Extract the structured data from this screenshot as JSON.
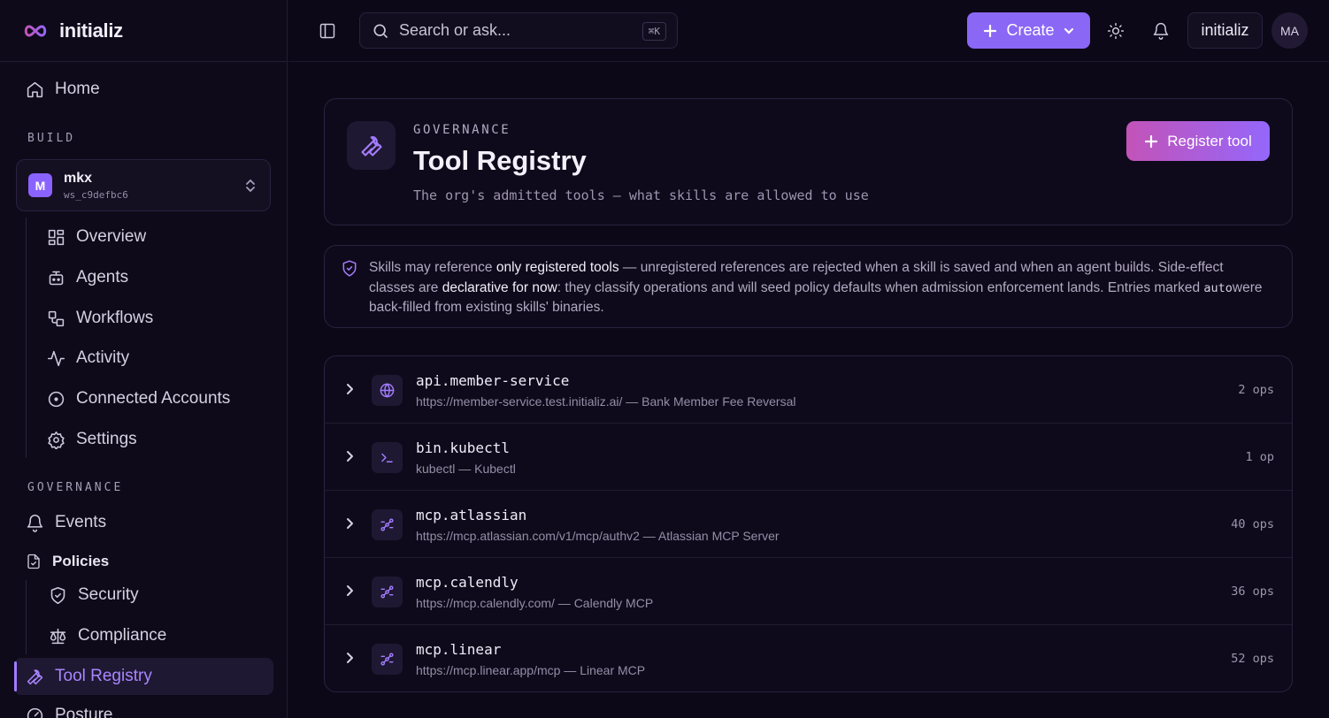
{
  "brand": {
    "name": "initializ"
  },
  "sidebar": {
    "home_label": "Home",
    "build_label": "BUILD",
    "workspace": {
      "avatar_letter": "M",
      "name": "mkx",
      "id": "ws_c9defbc6"
    },
    "build_items": [
      {
        "label": "Overview",
        "icon": "grid-icon"
      },
      {
        "label": "Agents",
        "icon": "robot-icon"
      },
      {
        "label": "Workflows",
        "icon": "workflow-icon"
      },
      {
        "label": "Activity",
        "icon": "activity-icon"
      },
      {
        "label": "Connected Accounts",
        "icon": "circle-dot-icon"
      },
      {
        "label": "Settings",
        "icon": "gear-icon"
      }
    ],
    "governance_label": "GOVERNANCE",
    "events_label": "Events",
    "policies_label": "Policies",
    "policy_items": [
      {
        "label": "Security",
        "icon": "shield-icon"
      },
      {
        "label": "Compliance",
        "icon": "scale-icon"
      }
    ],
    "tool_registry_label": "Tool Registry",
    "posture_label": "Posture"
  },
  "topbar": {
    "search_placeholder": "Search or ask...",
    "search_shortcut": "⌘K",
    "create_label": "Create",
    "org_label": "initializ",
    "user_initials": "MA"
  },
  "header": {
    "eyebrow": "GOVERNANCE",
    "title": "Tool Registry",
    "subtitle": "The org's admitted tools — what skills are allowed to use",
    "register_label": "Register tool"
  },
  "info": {
    "p1": "Skills may reference ",
    "b1": "only registered tools",
    "p2": " — unregistered references are rejected when a skill is saved and when an agent builds. Side-effect classes are ",
    "b2": "declarative for now",
    "p3": ": they classify operations and will seed policy defaults when admission enforcement lands. Entries marked ",
    "code": "auto",
    "p4": "were back-filled from existing skills' binaries."
  },
  "tools": [
    {
      "name": "api.member-service",
      "desc": "https://member-service.test.initializ.ai/ — Bank Member Fee Reversal",
      "ops": "2 ops",
      "icon": "globe-icon"
    },
    {
      "name": "bin.kubectl",
      "desc": "kubectl — Kubectl",
      "ops": "1 op",
      "icon": "terminal-icon"
    },
    {
      "name": "mcp.atlassian",
      "desc": "https://mcp.atlassian.com/v1/mcp/authv2 — Atlassian MCP Server",
      "ops": "40 ops",
      "icon": "network-icon"
    },
    {
      "name": "mcp.calendly",
      "desc": "https://mcp.calendly.com/ — Calendly MCP",
      "ops": "36 ops",
      "icon": "network-icon"
    },
    {
      "name": "mcp.linear",
      "desc": "https://mcp.linear.app/mcp — Linear MCP",
      "ops": "52 ops",
      "icon": "network-icon"
    }
  ],
  "colors": {
    "accent": "#8b67f5",
    "accent_light": "#a37dff",
    "background": "#0c0817"
  }
}
